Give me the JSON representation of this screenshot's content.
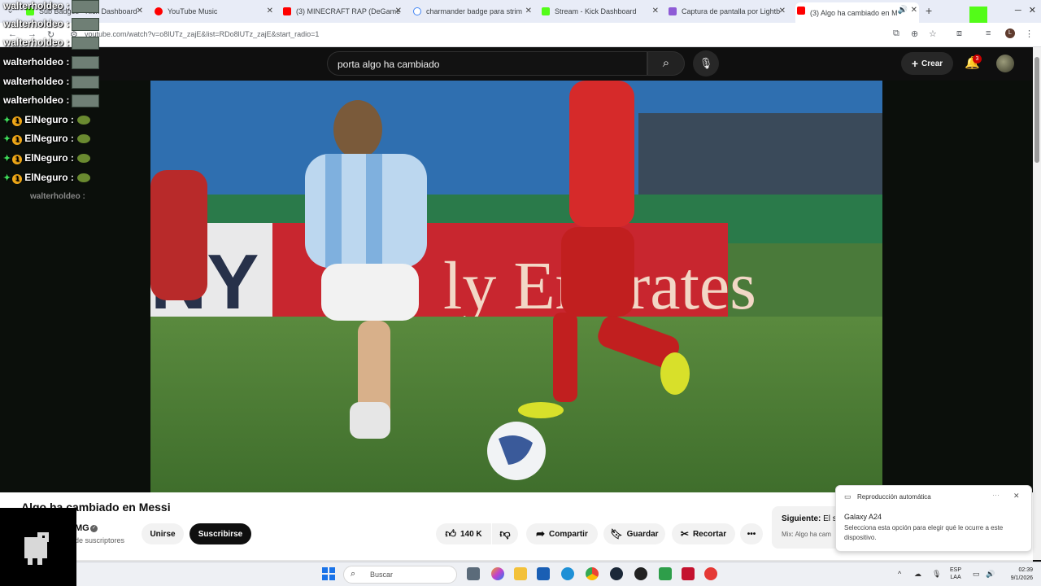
{
  "browser": {
    "tabs": [
      {
        "label": "Sub Badges - Kick Dashboard",
        "fav_color": "#53fc18"
      },
      {
        "label": "YouTube Music",
        "fav_color": "#ff0000"
      },
      {
        "label": "(3) MINECRAFT RAP (DeGame",
        "fav_color": "#ff0000"
      },
      {
        "label": "charmander badge para strim",
        "fav_color": "#4285f4"
      },
      {
        "label": "Stream - Kick Dashboard",
        "fav_color": "#53fc18"
      },
      {
        "label": "Captura de pantalla por Lightb",
        "fav_color": "#8e5bd6"
      },
      {
        "label": "(3) Algo ha cambiado en M",
        "fav_color": "#ff0000"
      }
    ],
    "url": "youtube.com/watch?v=o8lUTz_zajE&list=RDo8lUTz_zajE&start_radio=1",
    "profile_initial": "L"
  },
  "youtube": {
    "search_value": "porta algo ha cambiado",
    "create_label": "Crear",
    "notifications_count": "3",
    "video_title": "Algo ha cambiado en Messi",
    "channel_name": "MG",
    "subscribers": "de suscriptores",
    "join_label": "Unirse",
    "subscribe_label": "Suscribirse",
    "likes": "140 K",
    "share_label": "Compartir",
    "save_label": "Guardar",
    "clip_label": "Recortar",
    "next_label": "Siguiente:",
    "next_title": "El s",
    "next_sub": "Mix: Algo ha cam",
    "ad_text_left": "NY",
    "ad_text_right": "ly Emirates"
  },
  "autoplay_notification": {
    "header": "Reproducción automática",
    "title": "Galaxy A24",
    "body": "Selecciona esta opción para elegir qué le ocurre a este dispositivo."
  },
  "chat": [
    {
      "user": "walterholdeo :",
      "type": "emote"
    },
    {
      "user": "walterholdeo :",
      "type": "emote"
    },
    {
      "user": "walterholdeo :",
      "type": "emote"
    },
    {
      "user": "walterholdeo :",
      "type": "emote"
    },
    {
      "user": "walterholdeo :",
      "type": "emote"
    },
    {
      "user": "walterholdeo :",
      "type": "emote"
    },
    {
      "user": "ElNeguro :",
      "type": "blob"
    },
    {
      "user": "ElNeguro :",
      "type": "blob"
    },
    {
      "user": "ElNeguro :",
      "type": "blob"
    },
    {
      "user": "ElNeguro :",
      "type": "blob"
    },
    {
      "user": "walterholdeo :",
      "type": "faded"
    }
  ],
  "taskbar": {
    "search_placeholder": "Buscar",
    "lang_top": "ESP",
    "lang_bottom": "LAA",
    "time": "02:39",
    "date": "9/1/2026"
  }
}
